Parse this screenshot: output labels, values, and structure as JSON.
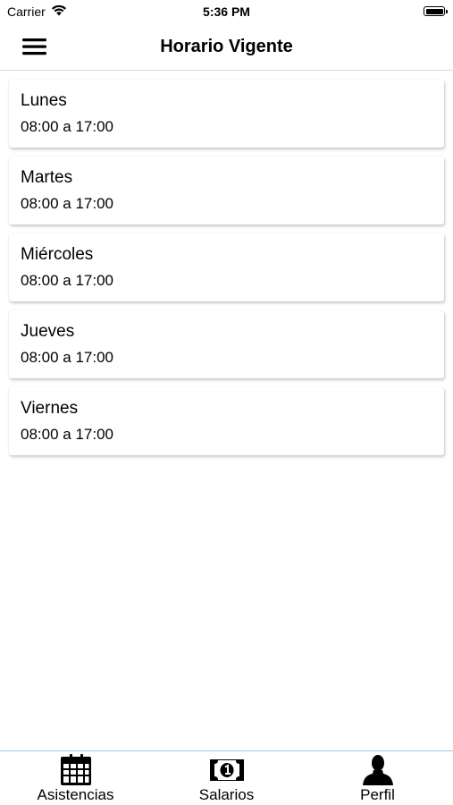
{
  "status_bar": {
    "carrier": "Carrier",
    "time": "5:36 PM",
    "wifi_icon": "wifi-icon",
    "battery_icon": "battery-icon"
  },
  "header": {
    "title": "Horario Vigente",
    "menu_icon": "hamburger-menu-icon"
  },
  "schedule": {
    "days": [
      {
        "name": "Lunes",
        "hours": "08:00 a 17:00"
      },
      {
        "name": "Martes",
        "hours": "08:00 a 17:00"
      },
      {
        "name": "Miércoles",
        "hours": "08:00 a 17:00"
      },
      {
        "name": "Jueves",
        "hours": "08:00 a 17:00"
      },
      {
        "name": "Viernes",
        "hours": "08:00 a 17:00"
      }
    ]
  },
  "tab_bar": {
    "tabs": [
      {
        "label": "Asistencias",
        "icon": "calendar-icon"
      },
      {
        "label": "Salarios",
        "icon": "money-bill-icon"
      },
      {
        "label": "Perfil",
        "icon": "user-icon"
      }
    ]
  },
  "colors": {
    "tab_bar_border": "#9fc6e4",
    "header_border": "#d9d9d9"
  }
}
